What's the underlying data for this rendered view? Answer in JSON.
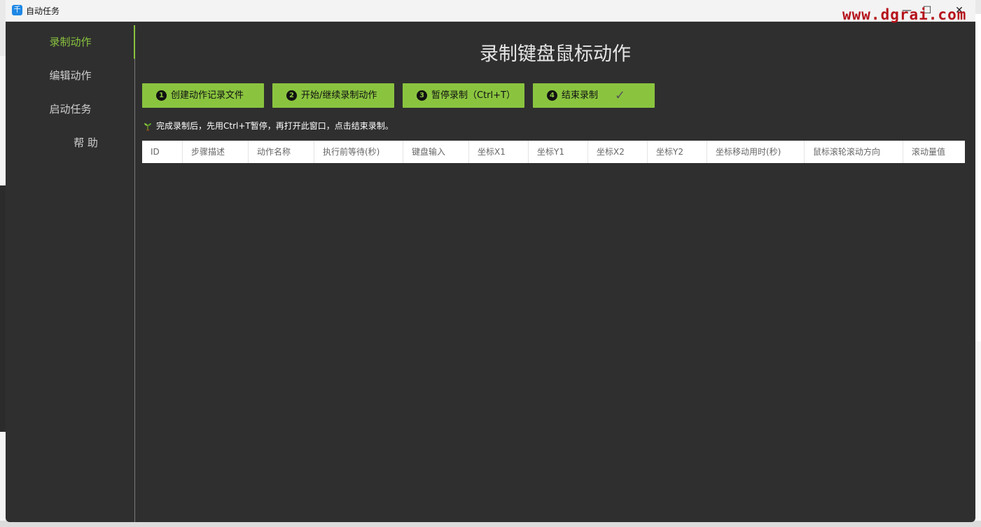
{
  "window": {
    "title": "自动任务",
    "minimize": "—",
    "maximize": "☐",
    "close": "✕"
  },
  "watermark": "www.dgrai.com",
  "sidebar": {
    "items": [
      {
        "label": "录制动作",
        "active": true
      },
      {
        "label": "编辑动作",
        "active": false
      },
      {
        "label": "启动任务",
        "active": false
      },
      {
        "label": "帮 助",
        "active": false
      }
    ]
  },
  "main": {
    "title": "录制键盘鼠标动作",
    "buttons": [
      {
        "num": "1",
        "label": "创建动作记录文件"
      },
      {
        "num": "2",
        "label": "开始/继续录制动作"
      },
      {
        "num": "3",
        "label": "暂停录制（Ctrl+T）"
      },
      {
        "num": "4",
        "label": "结束录制",
        "check": "✓"
      }
    ],
    "hint": "完成录制后，先用Ctrl+T暂停，再打开此窗口，点击结束录制。",
    "table": {
      "columns": [
        "ID",
        "步骤描述",
        "动作名称",
        "执行前等待(秒)",
        "键盘输入",
        "坐标X1",
        "坐标Y1",
        "坐标X2",
        "坐标Y2",
        "坐标移动用时(秒)",
        "鼠标滚轮滚动方向",
        "滚动量值"
      ],
      "rows": []
    }
  },
  "colors": {
    "accent": "#8ac43f",
    "background": "#2f2f2f",
    "watermark": "#b5121b"
  }
}
